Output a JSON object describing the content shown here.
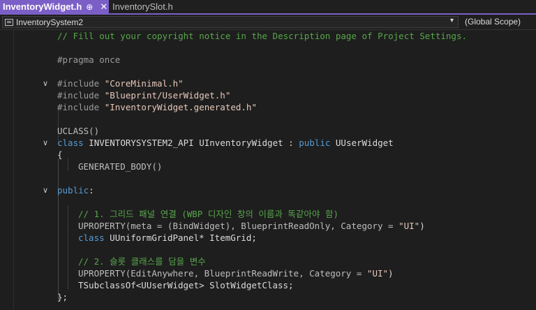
{
  "tabs": [
    {
      "label": "InventoryWidget.h",
      "pin": "⊕",
      "close": "✕",
      "active": true
    },
    {
      "label": "InventorySlot.h",
      "active": false
    }
  ],
  "navbar": {
    "project_scope": "InventorySystem2",
    "global_scope": "(Global Scope)"
  },
  "code": {
    "l1": "// Fill out your copyright notice in the Description page of Project Settings.",
    "l2_pre": "#pragma once",
    "l3_inc": "#include ",
    "l3_str": "\"CoreMinimal.h\"",
    "l4_inc": "#include ",
    "l4_str": "\"Blueprint/UserWidget.h\"",
    "l5_inc": "#include ",
    "l5_str": "\"InventoryWidget.generated.h\"",
    "l6": "UCLASS()",
    "l7_kw": "class",
    "l7_api": " INVENTORYSYSTEM2_API ",
    "l7_name": "UInventoryWidget",
    "l7_colon": " : ",
    "l7_pub": "public",
    "l7_base": " UUserWidget",
    "l8": "{",
    "l9": "GENERATED_BODY()",
    "l10_kw": "public",
    "l10_colon": ":",
    "l11": "// 1. 그리드 패널 연결 (WBP 디자인 창의 이름과 똑같아야 함)",
    "l12_a": "UPROPERTY(meta = (BindWidget), BlueprintReadOnly, Category = ",
    "l12_str": "\"UI\"",
    "l12_b": ")",
    "l13_kw": "class",
    "l13_rest": " UUniformGridPanel* ItemGrid;",
    "l14": "// 2. 슬롯 클래스를 담을 변수",
    "l15_a": "UPROPERTY(EditAnywhere, BlueprintReadWrite, Category = ",
    "l15_str": "\"UI\"",
    "l15_b": ")",
    "l16": "TSubclassOf<UUserWidget> SlotWidgetClass;",
    "l17": "};"
  },
  "fold_glyph": "∨"
}
